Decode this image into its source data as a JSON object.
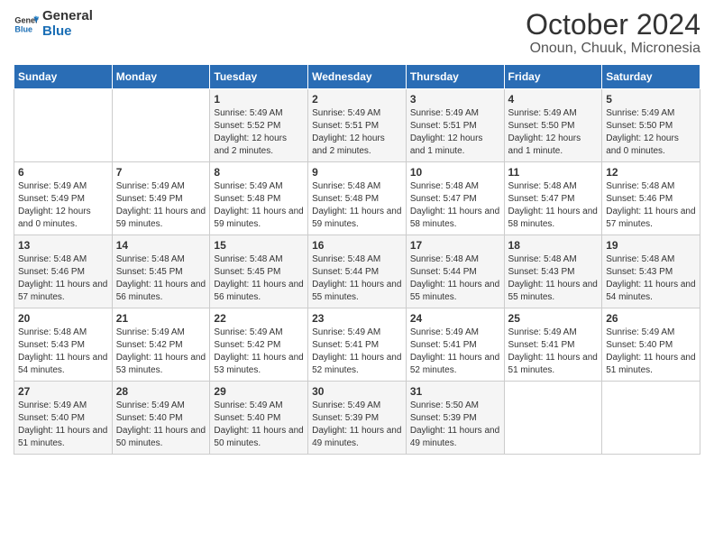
{
  "logo": {
    "text_general": "General",
    "text_blue": "Blue"
  },
  "title": "October 2024",
  "subtitle": "Onoun, Chuuk, Micronesia",
  "days_of_week": [
    "Sunday",
    "Monday",
    "Tuesday",
    "Wednesday",
    "Thursday",
    "Friday",
    "Saturday"
  ],
  "weeks": [
    [
      {
        "day": "",
        "info": ""
      },
      {
        "day": "",
        "info": ""
      },
      {
        "day": "1",
        "info": "Sunrise: 5:49 AM\nSunset: 5:52 PM\nDaylight: 12 hours and 2 minutes."
      },
      {
        "day": "2",
        "info": "Sunrise: 5:49 AM\nSunset: 5:51 PM\nDaylight: 12 hours and 2 minutes."
      },
      {
        "day": "3",
        "info": "Sunrise: 5:49 AM\nSunset: 5:51 PM\nDaylight: 12 hours and 1 minute."
      },
      {
        "day": "4",
        "info": "Sunrise: 5:49 AM\nSunset: 5:50 PM\nDaylight: 12 hours and 1 minute."
      },
      {
        "day": "5",
        "info": "Sunrise: 5:49 AM\nSunset: 5:50 PM\nDaylight: 12 hours and 0 minutes."
      }
    ],
    [
      {
        "day": "6",
        "info": "Sunrise: 5:49 AM\nSunset: 5:49 PM\nDaylight: 12 hours and 0 minutes."
      },
      {
        "day": "7",
        "info": "Sunrise: 5:49 AM\nSunset: 5:49 PM\nDaylight: 11 hours and 59 minutes."
      },
      {
        "day": "8",
        "info": "Sunrise: 5:49 AM\nSunset: 5:48 PM\nDaylight: 11 hours and 59 minutes."
      },
      {
        "day": "9",
        "info": "Sunrise: 5:48 AM\nSunset: 5:48 PM\nDaylight: 11 hours and 59 minutes."
      },
      {
        "day": "10",
        "info": "Sunrise: 5:48 AM\nSunset: 5:47 PM\nDaylight: 11 hours and 58 minutes."
      },
      {
        "day": "11",
        "info": "Sunrise: 5:48 AM\nSunset: 5:47 PM\nDaylight: 11 hours and 58 minutes."
      },
      {
        "day": "12",
        "info": "Sunrise: 5:48 AM\nSunset: 5:46 PM\nDaylight: 11 hours and 57 minutes."
      }
    ],
    [
      {
        "day": "13",
        "info": "Sunrise: 5:48 AM\nSunset: 5:46 PM\nDaylight: 11 hours and 57 minutes."
      },
      {
        "day": "14",
        "info": "Sunrise: 5:48 AM\nSunset: 5:45 PM\nDaylight: 11 hours and 56 minutes."
      },
      {
        "day": "15",
        "info": "Sunrise: 5:48 AM\nSunset: 5:45 PM\nDaylight: 11 hours and 56 minutes."
      },
      {
        "day": "16",
        "info": "Sunrise: 5:48 AM\nSunset: 5:44 PM\nDaylight: 11 hours and 55 minutes."
      },
      {
        "day": "17",
        "info": "Sunrise: 5:48 AM\nSunset: 5:44 PM\nDaylight: 11 hours and 55 minutes."
      },
      {
        "day": "18",
        "info": "Sunrise: 5:48 AM\nSunset: 5:43 PM\nDaylight: 11 hours and 55 minutes."
      },
      {
        "day": "19",
        "info": "Sunrise: 5:48 AM\nSunset: 5:43 PM\nDaylight: 11 hours and 54 minutes."
      }
    ],
    [
      {
        "day": "20",
        "info": "Sunrise: 5:48 AM\nSunset: 5:43 PM\nDaylight: 11 hours and 54 minutes."
      },
      {
        "day": "21",
        "info": "Sunrise: 5:49 AM\nSunset: 5:42 PM\nDaylight: 11 hours and 53 minutes."
      },
      {
        "day": "22",
        "info": "Sunrise: 5:49 AM\nSunset: 5:42 PM\nDaylight: 11 hours and 53 minutes."
      },
      {
        "day": "23",
        "info": "Sunrise: 5:49 AM\nSunset: 5:41 PM\nDaylight: 11 hours and 52 minutes."
      },
      {
        "day": "24",
        "info": "Sunrise: 5:49 AM\nSunset: 5:41 PM\nDaylight: 11 hours and 52 minutes."
      },
      {
        "day": "25",
        "info": "Sunrise: 5:49 AM\nSunset: 5:41 PM\nDaylight: 11 hours and 51 minutes."
      },
      {
        "day": "26",
        "info": "Sunrise: 5:49 AM\nSunset: 5:40 PM\nDaylight: 11 hours and 51 minutes."
      }
    ],
    [
      {
        "day": "27",
        "info": "Sunrise: 5:49 AM\nSunset: 5:40 PM\nDaylight: 11 hours and 51 minutes."
      },
      {
        "day": "28",
        "info": "Sunrise: 5:49 AM\nSunset: 5:40 PM\nDaylight: 11 hours and 50 minutes."
      },
      {
        "day": "29",
        "info": "Sunrise: 5:49 AM\nSunset: 5:40 PM\nDaylight: 11 hours and 50 minutes."
      },
      {
        "day": "30",
        "info": "Sunrise: 5:49 AM\nSunset: 5:39 PM\nDaylight: 11 hours and 49 minutes."
      },
      {
        "day": "31",
        "info": "Sunrise: 5:50 AM\nSunset: 5:39 PM\nDaylight: 11 hours and 49 minutes."
      },
      {
        "day": "",
        "info": ""
      },
      {
        "day": "",
        "info": ""
      }
    ]
  ]
}
